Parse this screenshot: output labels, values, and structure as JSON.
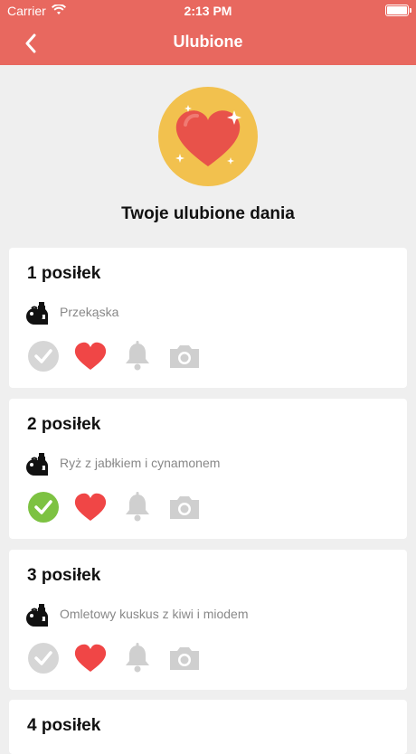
{
  "status_bar": {
    "carrier": "Carrier",
    "time": "2:13 PM"
  },
  "nav": {
    "title": "Ulubione",
    "back_icon": "chevron-left-icon"
  },
  "hero": {
    "icon": "heart-sparkles-icon",
    "title": "Twoje ulubione dania"
  },
  "meals": [
    {
      "title": "1 posiłek",
      "name": "Przekąska",
      "done": false,
      "favorite": true
    },
    {
      "title": "2 posiłek",
      "name": "Ryż z jabłkiem i cynamonem",
      "done": true,
      "favorite": true
    },
    {
      "title": "3 posiłek",
      "name": "Omletowy kuskus z kiwi i miodem",
      "done": false,
      "favorite": true
    },
    {
      "title": "4 posiłek",
      "name": "",
      "done": false,
      "favorite": true
    }
  ],
  "colors": {
    "header": "#e8685f",
    "check_done": "#7dc242",
    "check_pending": "#d6d6d6",
    "heart": "#f04646",
    "inactive_icon": "#cfcfcf",
    "badge": "#f2c14e"
  }
}
